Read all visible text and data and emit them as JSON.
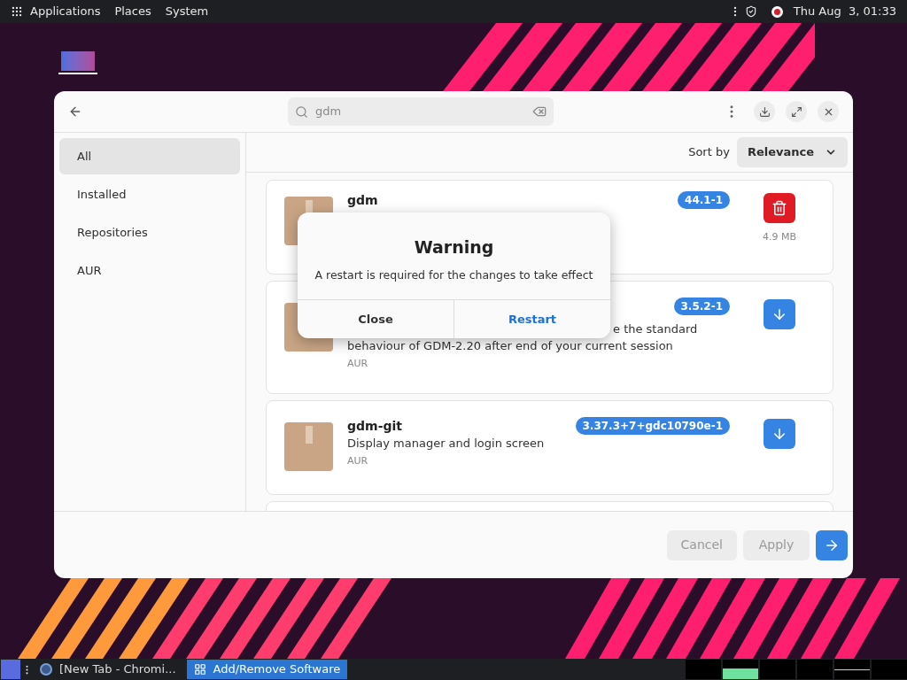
{
  "top_panel": {
    "menus": [
      "Applications",
      "Places",
      "System"
    ],
    "clock": "Thu Aug  3, 01:33"
  },
  "window": {
    "search": {
      "value": "gdm"
    },
    "sidebar": {
      "items": [
        {
          "label": "All",
          "selected": true
        },
        {
          "label": "Installed",
          "selected": false
        },
        {
          "label": "Repositories",
          "selected": false
        },
        {
          "label": "AUR",
          "selected": false
        }
      ]
    },
    "sort": {
      "label": "Sort by",
      "value": "Relevance"
    },
    "packages": [
      {
        "name": "gdm",
        "version": "44.1-1",
        "size": "4.9 MB",
        "kind": "remove"
      },
      {
        "description_lines": [
          "e the standard",
          "behaviour of GDM-2.20 after end of your current session"
        ],
        "version": "3.5.2-1",
        "source": "AUR",
        "kind": "install"
      },
      {
        "name": "gdm-git",
        "description_lines": [
          "Display manager and login screen"
        ],
        "version": "3.37.3+7+gdc10790e-1",
        "source": "AUR",
        "kind": "install"
      }
    ],
    "footer": {
      "buttons": [
        {
          "label": "Cancel",
          "disabled": true
        },
        {
          "label": "Apply",
          "disabled": true
        }
      ]
    }
  },
  "dialog": {
    "title": "Warning",
    "message": "A restart is required for the changes to take effect",
    "buttons": [
      {
        "label": "Close",
        "kind": "plain"
      },
      {
        "label": "Restart",
        "kind": "suggested"
      }
    ]
  },
  "taskbar": {
    "tasks": [
      {
        "label": "[New Tab - Chromi...",
        "selected": false
      },
      {
        "label": "Add/Remove Software",
        "selected": true
      }
    ]
  }
}
